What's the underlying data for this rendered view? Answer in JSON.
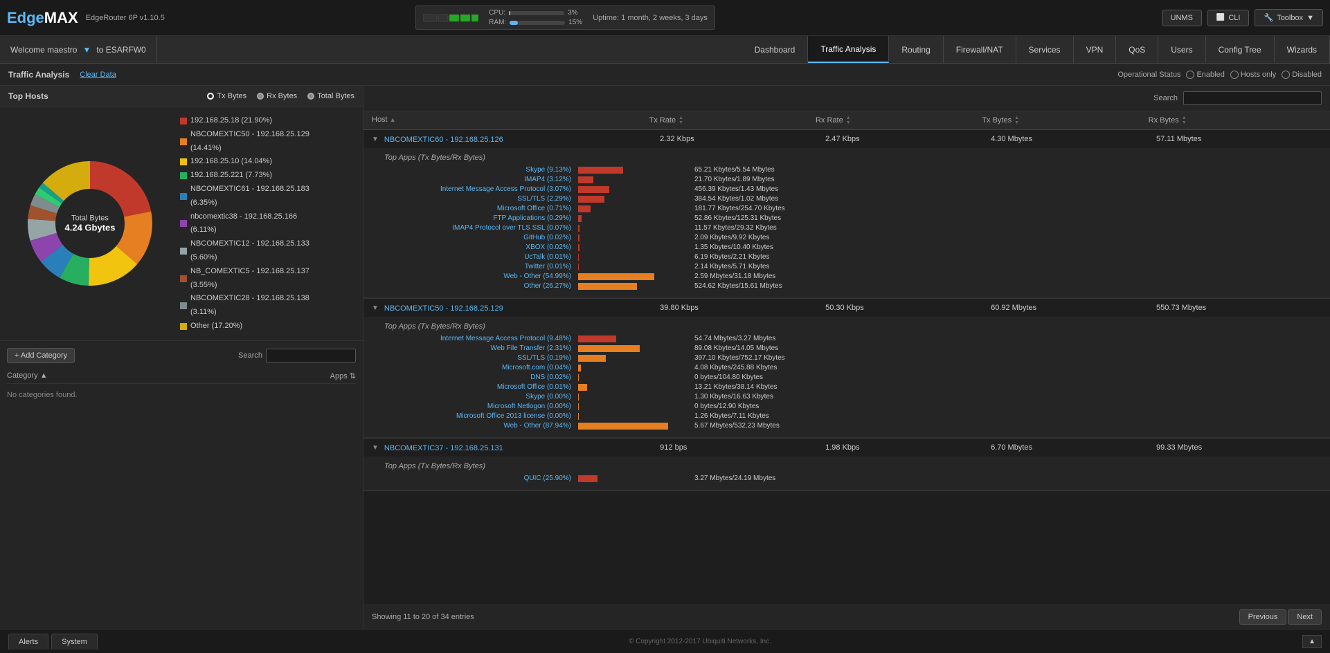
{
  "app": {
    "name": "EdgeMAX",
    "subtitle": "EdgeRouter 6P v1.10.5"
  },
  "system": {
    "cpu_label": "CPU:",
    "cpu_val": "3%",
    "cpu_pct": 3,
    "ram_label": "RAM:",
    "ram_val": "15%",
    "ram_pct": 15,
    "uptime_label": "Uptime:",
    "uptime_val": "1 month, 2 weeks, 3 days"
  },
  "top_buttons": {
    "unms": "UNMS",
    "cli": "CLI",
    "toolbox": "Toolbox"
  },
  "nav": {
    "welcome": "Welcome maestro",
    "to": "to ESARFW0",
    "tabs": [
      {
        "label": "Dashboard",
        "active": false
      },
      {
        "label": "Traffic Analysis",
        "active": true
      },
      {
        "label": "Routing",
        "active": false
      },
      {
        "label": "Firewall/NAT",
        "active": false
      },
      {
        "label": "Services",
        "active": false
      },
      {
        "label": "VPN",
        "active": false
      },
      {
        "label": "QoS",
        "active": false
      },
      {
        "label": "Users",
        "active": false
      },
      {
        "label": "Config Tree",
        "active": false
      },
      {
        "label": "Wizards",
        "active": false
      }
    ]
  },
  "subheader": {
    "title": "Traffic Analysis",
    "clear_data": "Clear Data",
    "operational_status": "Operational Status",
    "enabled": "Enabled",
    "hosts_only": "Hosts only",
    "disabled": "Disabled"
  },
  "top_hosts": {
    "title": "Top Hosts",
    "radio_options": [
      "Tx Bytes",
      "Rx Bytes",
      "Total Bytes"
    ],
    "donut_center_label": "Total Bytes",
    "donut_total": "4.24 Gbytes",
    "legend": [
      {
        "color": "#c0392b",
        "label": "192.168.25.18 (21.90%)"
      },
      {
        "color": "#e67e22",
        "label": "NBCOMEXTIC50 - 192.168.25.129 (14.41%)"
      },
      {
        "color": "#f1c40f",
        "label": "192.168.25.10 (14.04%)"
      },
      {
        "color": "#27ae60",
        "label": "192.168.25.221 (7.73%)"
      },
      {
        "color": "#2980b9",
        "label": "NBCOMEXTIC61 - 192.168.25.183 (6.35%)"
      },
      {
        "color": "#8e44ad",
        "label": "nbcomextic38 - 192.168.25.166 (6.11%)"
      },
      {
        "color": "#95a5a6",
        "label": "NBCOMEXTIC12 - 192.168.25.133 (5.60%)"
      },
      {
        "color": "#a0522d",
        "label": "NB_COMEXTIC5 - 192.168.25.137 (3.55%)"
      },
      {
        "color": "#7f8c8d",
        "label": "NBCOMEXTIC28 - 192.168.25.138 (3.11%)"
      },
      {
        "color": "#d4ac0d",
        "label": "Other (17.20%)"
      }
    ],
    "donut_segments": [
      {
        "color": "#c0392b",
        "pct": 21.9
      },
      {
        "color": "#e67e22",
        "pct": 14.41
      },
      {
        "color": "#f1c40f",
        "pct": 14.04
      },
      {
        "color": "#27ae60",
        "pct": 7.73
      },
      {
        "color": "#2980b9",
        "pct": 6.35
      },
      {
        "color": "#8e44ad",
        "pct": 6.11
      },
      {
        "color": "#95a5a6",
        "pct": 5.6
      },
      {
        "color": "#a0522d",
        "pct": 3.55
      },
      {
        "color": "#7f8c8d",
        "pct": 3.11
      },
      {
        "color": "#2ecc71",
        "pct": 2.0
      },
      {
        "color": "#16a085",
        "pct": 1.5
      },
      {
        "color": "#d4ac0d",
        "pct": 17.2
      }
    ]
  },
  "category": {
    "add_btn": "+ Add Category",
    "search_label": "Search",
    "search_placeholder": "",
    "col_category": "Category",
    "col_apps": "Apps",
    "no_data": "No categories found."
  },
  "table": {
    "search_label": "Search",
    "search_placeholder": "",
    "columns": {
      "host": "Host",
      "tx_rate": "Tx Rate",
      "rx_rate": "Rx Rate",
      "tx_bytes": "Tx Bytes",
      "rx_bytes": "Rx Bytes"
    },
    "rows": [
      {
        "host": "NBCOMEXTIC60 - 192.168.25.126",
        "tx_rate": "2.32 Kbps",
        "rx_rate": "2.47 Kbps",
        "tx_bytes": "4.30 Mbytes",
        "rx_bytes": "57.11 Mbytes",
        "expanded": true,
        "top_apps_title": "Top Apps (Tx Bytes/Rx Bytes)",
        "apps": [
          {
            "name": "Skype (9.13%)",
            "bar_pct": 65,
            "bar_color": "#c0392b",
            "value": "65.21 Kbytes/5.54 Mbytes"
          },
          {
            "name": "IMAP4 (3.12%)",
            "bar_pct": 21,
            "bar_color": "#c0392b",
            "value": "21.70 Kbytes/1.89 Mbytes"
          },
          {
            "name": "Internet Message Access Protocol (3.07%)",
            "bar_pct": 45,
            "bar_color": "#c0392b",
            "value": "456.39 Kbytes/1.43 Mbytes"
          },
          {
            "name": "SSL/TLS (2.29%)",
            "bar_pct": 38,
            "bar_color": "#c0392b",
            "value": "384.54 Kbytes/1.02 Mbytes"
          },
          {
            "name": "Microsoft Office (0.71%)",
            "bar_pct": 18,
            "bar_color": "#c0392b",
            "value": "181.77 Kbytes/254.70 Kbytes"
          },
          {
            "name": "FTP Applications (0.29%)",
            "bar_pct": 5,
            "bar_color": "#c0392b",
            "value": "52.86 Kbytes/125.31 Kbytes"
          },
          {
            "name": "IMAP4 Protocol over TLS SSL (0.07%)",
            "bar_pct": 2,
            "bar_color": "#c0392b",
            "value": "11.57 Kbytes/29.32 Kbytes"
          },
          {
            "name": "GitHub (0.02%)",
            "bar_pct": 1,
            "bar_color": "#c0392b",
            "value": "2.09 Kbytes/9.92 Kbytes"
          },
          {
            "name": "XBOX (0.02%)",
            "bar_pct": 1,
            "bar_color": "#c0392b",
            "value": "1.35 Kbytes/10.40 Kbytes"
          },
          {
            "name": "UcTalk (0.01%)",
            "bar_pct": 1,
            "bar_color": "#c0392b",
            "value": "6.19 Kbytes/2.21 Kbytes"
          },
          {
            "name": "Twitter (0.01%)",
            "bar_pct": 1,
            "bar_color": "#c0392b",
            "value": "2.14 Kbytes/5.71 Kbytes"
          },
          {
            "name": "Web - Other (54.99%)",
            "bar_pct": 100,
            "bar_color": "#e67e22",
            "value": "2.59 Mbytes/31.18 Mbytes"
          },
          {
            "name": "Other (26.27%)",
            "bar_pct": 80,
            "bar_color": "#e67e22",
            "value": "524.62 Kbytes/15.61 Mbytes"
          }
        ]
      },
      {
        "host": "NBCOMEXTIC50 - 192.168.25.129",
        "tx_rate": "39.80 Kbps",
        "rx_rate": "50.30 Kbps",
        "tx_bytes": "60.92 Mbytes",
        "rx_bytes": "550.73 Mbytes",
        "expanded": true,
        "top_apps_title": "Top Apps (Tx Bytes/Rx Bytes)",
        "apps": [
          {
            "name": "Internet Message Access Protocol (9.48%)",
            "bar_pct": 55,
            "bar_color": "#c0392b",
            "value": "54.74 Mbytes/3.27 Mbytes"
          },
          {
            "name": "Web File Transfer (2.31%)",
            "bar_pct": 89,
            "bar_color": "#e67e22",
            "value": "89.08 Kbytes/14.05 Mbytes"
          },
          {
            "name": "SSL/TLS (0.19%)",
            "bar_pct": 40,
            "bar_color": "#e67e22",
            "value": "397.10 Kbytes/752.17 Kbytes"
          },
          {
            "name": "Microsoft.com (0.04%)",
            "bar_pct": 4,
            "bar_color": "#e67e22",
            "value": "4.08 Kbytes/245.88 Kbytes"
          },
          {
            "name": "DNS (0.02%)",
            "bar_pct": 1,
            "bar_color": "#e67e22",
            "value": "0 bytes/104.80 Kbytes"
          },
          {
            "name": "Microsoft Office (0.01%)",
            "bar_pct": 13,
            "bar_color": "#e67e22",
            "value": "13.21 Kbytes/38.14 Kbytes"
          },
          {
            "name": "Skype (0.00%)",
            "bar_pct": 1,
            "bar_color": "#e67e22",
            "value": "1.30 Kbytes/16.63 Kbytes"
          },
          {
            "name": "Microsoft Netlogon (0.00%)",
            "bar_pct": 1,
            "bar_color": "#e67e22",
            "value": "0 bytes/12.90 Kbytes"
          },
          {
            "name": "Microsoft Office 2013 license (0.00%)",
            "bar_pct": 1,
            "bar_color": "#e67e22",
            "value": "1.26 Kbytes/7.11 Kbytes"
          },
          {
            "name": "Web - Other (87.94%)",
            "bar_pct": 100,
            "bar_color": "#e67e22",
            "value": "5.67 Mbytes/532.23 Mbytes"
          }
        ]
      },
      {
        "host": "NBCOMEXTIC37 - 192.168.25.131",
        "tx_rate": "912 bps",
        "rx_rate": "1.98 Kbps",
        "tx_bytes": "6.70 Mbytes",
        "rx_bytes": "99.33 Mbytes",
        "expanded": true,
        "top_apps_title": "Top Apps (Tx Bytes/Rx Bytes)",
        "apps": [
          {
            "name": "QUIC (25.90%)",
            "bar_pct": 28,
            "bar_color": "#c0392b",
            "value": "3.27 Mbytes/24.19 Mbytes"
          }
        ]
      }
    ],
    "showing": "Showing 11 to 20 of 34 entries",
    "pagination": {
      "previous": "Previous",
      "next": "Next"
    }
  },
  "footer": {
    "alerts": "Alerts",
    "system": "System",
    "copyright": "© Copyright 2012-2017 Ubiquiti Networks, Inc."
  }
}
